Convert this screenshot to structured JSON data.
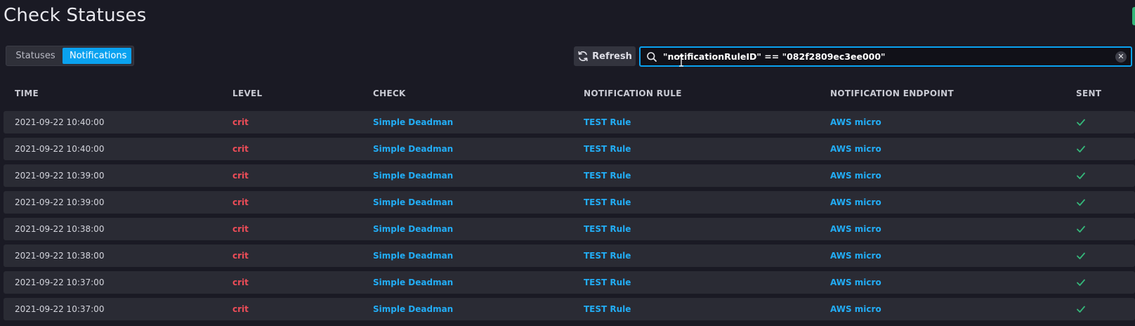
{
  "page": {
    "title": "Check Statuses"
  },
  "toggle": {
    "statuses_label": "Statuses",
    "notifications_label": "Notifications",
    "active": "Notifications"
  },
  "toolbar": {
    "refresh_label": "Refresh"
  },
  "search": {
    "value": "\"notificationRuleID\" == \"082f2809ec3ee000\"",
    "clear_icon": "close-icon"
  },
  "colors": {
    "accent": "#0aa2f0",
    "crit": "#ee4d58",
    "link": "#22adf6",
    "sent": "#34b87a"
  },
  "table": {
    "headers": {
      "time": "TIME",
      "level": "LEVEL",
      "check": "CHECK",
      "rule": "NOTIFICATION RULE",
      "endpoint": "NOTIFICATION ENDPOINT",
      "sent": "SENT"
    },
    "rows": [
      {
        "time": "2021-09-22 10:40:00",
        "level": "crit",
        "check": "Simple Deadman",
        "rule": "TEST Rule",
        "endpoint": "AWS micro",
        "sent": "check-icon"
      },
      {
        "time": "2021-09-22 10:40:00",
        "level": "crit",
        "check": "Simple Deadman",
        "rule": "TEST Rule",
        "endpoint": "AWS micro",
        "sent": "check-icon"
      },
      {
        "time": "2021-09-22 10:39:00",
        "level": "crit",
        "check": "Simple Deadman",
        "rule": "TEST Rule",
        "endpoint": "AWS micro",
        "sent": "check-icon"
      },
      {
        "time": "2021-09-22 10:39:00",
        "level": "crit",
        "check": "Simple Deadman",
        "rule": "TEST Rule",
        "endpoint": "AWS micro",
        "sent": "check-icon"
      },
      {
        "time": "2021-09-22 10:38:00",
        "level": "crit",
        "check": "Simple Deadman",
        "rule": "TEST Rule",
        "endpoint": "AWS micro",
        "sent": "check-icon"
      },
      {
        "time": "2021-09-22 10:38:00",
        "level": "crit",
        "check": "Simple Deadman",
        "rule": "TEST Rule",
        "endpoint": "AWS micro",
        "sent": "check-icon"
      },
      {
        "time": "2021-09-22 10:37:00",
        "level": "crit",
        "check": "Simple Deadman",
        "rule": "TEST Rule",
        "endpoint": "AWS micro",
        "sent": "check-icon"
      },
      {
        "time": "2021-09-22 10:37:00",
        "level": "crit",
        "check": "Simple Deadman",
        "rule": "TEST Rule",
        "endpoint": "AWS micro",
        "sent": "check-icon"
      }
    ]
  }
}
